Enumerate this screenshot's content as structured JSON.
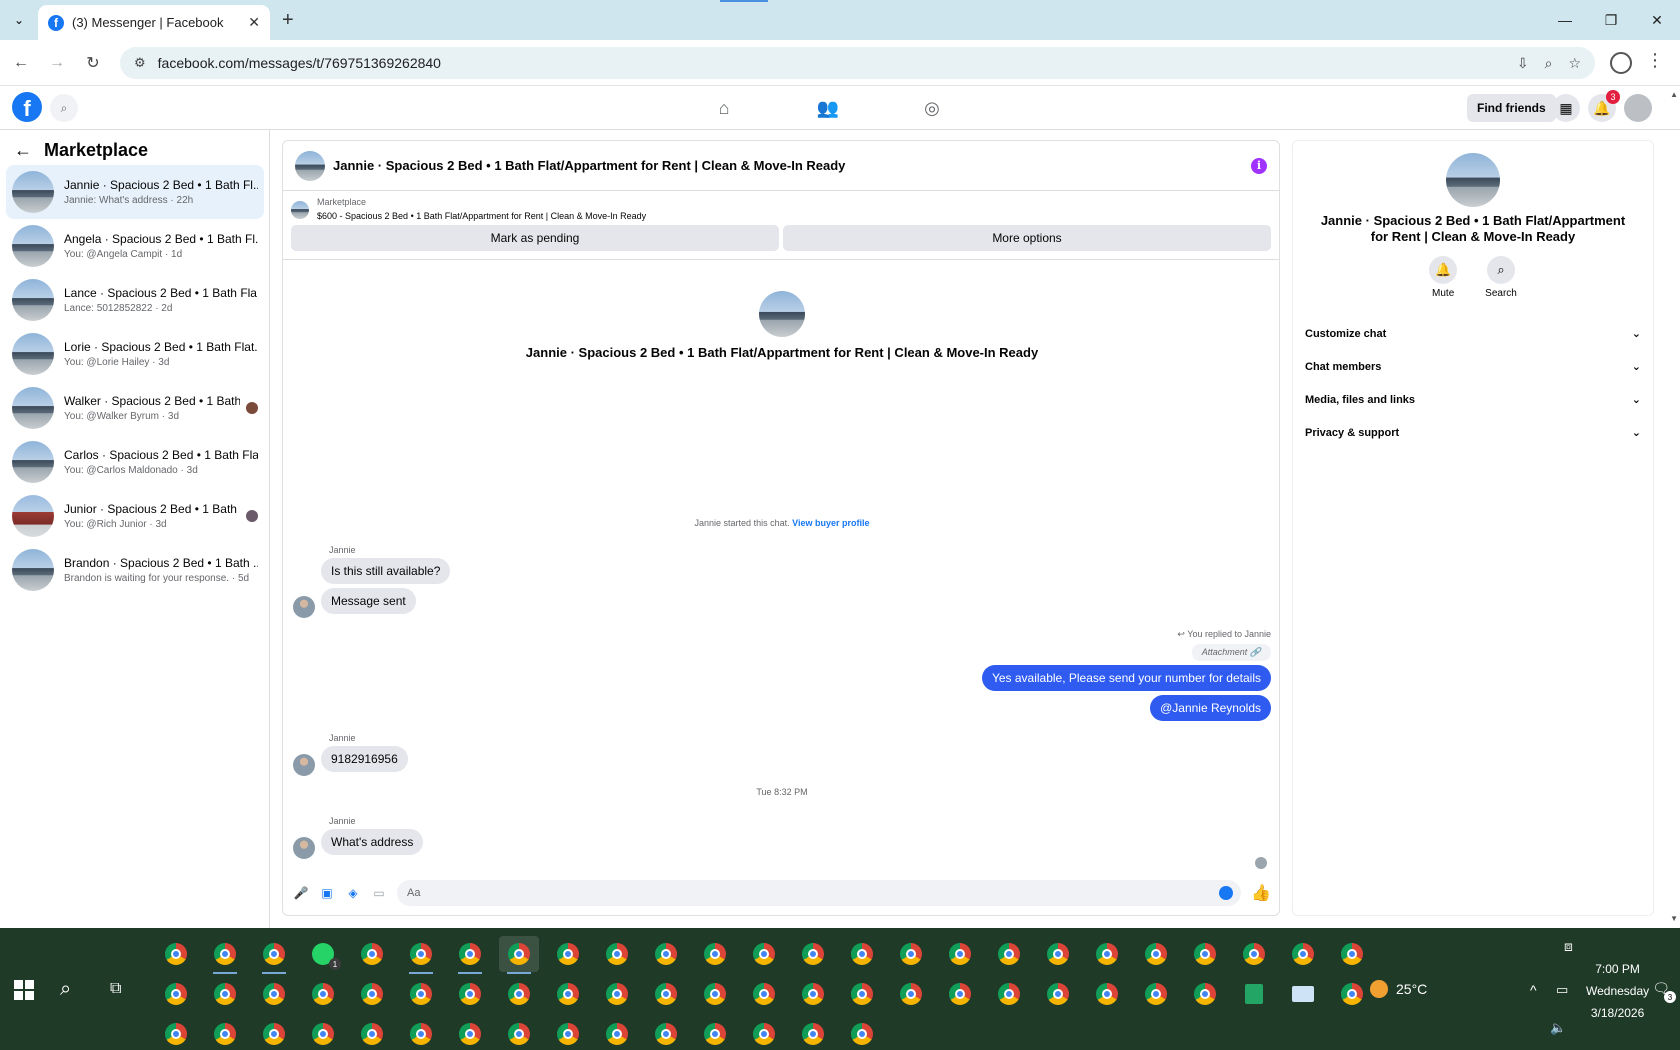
{
  "browser": {
    "tab_title": "(3) Messenger | Facebook",
    "url": "facebook.com/messages/t/769751369262840"
  },
  "fb_header": {
    "find_friends": "Find friends",
    "notification_count": "3"
  },
  "sidebar": {
    "title": "Marketplace",
    "conversations": [
      {
        "name": "Jannie · Spacious 2 Bed • 1 Bath Fl...",
        "preview": "Jannie: What's address · 22h",
        "active": true
      },
      {
        "name": "Angela · Spacious 2 Bed • 1 Bath Fl...",
        "preview": "You: @Angela Campit · 1d"
      },
      {
        "name": "Lance · Spacious 2 Bed • 1 Bath Fla...",
        "preview": "Lance: 5012852822 · 2d"
      },
      {
        "name": "Lorie · Spacious 2 Bed • 1 Bath Flat...",
        "preview": "You: @Lorie Hailey · 3d"
      },
      {
        "name": "Walker · Spacious 2 Bed • 1 Bath...",
        "preview": "You: @Walker Byrum · 3d"
      },
      {
        "name": "Carlos · Spacious 2 Bed • 1 Bath Fla...",
        "preview": "You: @Carlos Maldonado · 3d"
      },
      {
        "name": "Junior · Spacious 2 Bed • 1 Bath ...",
        "preview": "You: @Rich Junior · 3d"
      },
      {
        "name": "Brandon · Spacious 2 Bed • 1 Bath ...",
        "preview": "Brandon is waiting for your response. · 5d"
      }
    ]
  },
  "chat": {
    "title": "Jannie · Spacious 2 Bed • 1 Bath Flat/Appartment for Rent | Clean & Move-In Ready",
    "listing_label": "Marketplace",
    "listing_desc": "$600 - Spacious 2 Bed • 1 Bath Flat/Appartment for Rent | Clean & Move-In Ready",
    "mark_pending": "Mark as pending",
    "more_options": "More options",
    "intro_name": "Jannie · Spacious 2 Bed • 1 Bath Flat/Appartment for Rent | Clean & Move-In Ready",
    "started_text": "Jannie started this chat.",
    "view_profile": "View buyer profile",
    "sender": "Jannie",
    "msg1": "Is this still available?",
    "msg2": "Message sent",
    "replied_note": "You replied to Jannie",
    "attachment": "Attachment",
    "out1": "Yes available, Please send your number for details",
    "out2": "@Jannie Reynolds",
    "msg3": "9182916956",
    "timestamp": "Tue 8:32 PM",
    "msg4": "What's address",
    "composer_placeholder": "Aa"
  },
  "right_panel": {
    "name": "Jannie · Spacious 2 Bed • 1 Bath Flat/Appartment for Rent | Clean & Move-In Ready",
    "mute": "Mute",
    "search": "Search",
    "sections": [
      "Customize chat",
      "Chat members",
      "Media, files and links",
      "Privacy & support"
    ]
  },
  "taskbar": {
    "weather": "25°C",
    "time": "7:00 PM",
    "day": "Wednesday",
    "date": "3/18/2026",
    "whatsapp_badge": "1",
    "notify_badge": "3"
  }
}
